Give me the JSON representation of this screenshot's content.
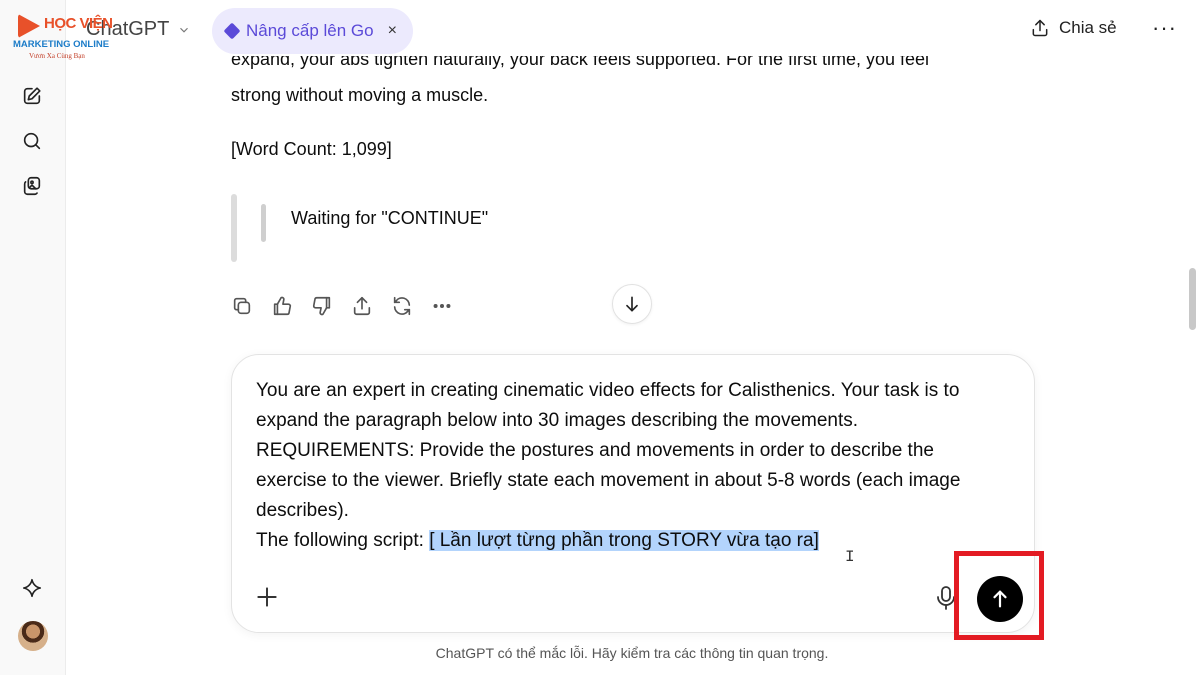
{
  "watermark": {
    "line1": "HỌC VIỆN",
    "line2": "MARKETING ONLINE",
    "line3": "Vươn Xa Cùng Bạn"
  },
  "header": {
    "model_name": "ChatGPT",
    "upgrade_label": "Nâng cấp lên Go",
    "upgrade_close": "×",
    "share_label": "Chia sẻ",
    "more_label": "···"
  },
  "conversation": {
    "cut_line": "expand, your abs tighten naturally, your back feels supported. For the first time, you feel",
    "line_strong": "strong without moving a muscle.",
    "word_count": "[Word Count: 1,099]",
    "waiting": "Waiting for \"CONTINUE\""
  },
  "composer": {
    "line1": "You are an expert in creating cinematic video effects for Calisthenics. Your task is to",
    "line2": "expand the paragraph below into 30 images describing the movements.",
    "line3": "REQUIREMENTS: Provide the postures and movements in order to describe the",
    "line4": "exercise to the viewer. Briefly state each movement in about 5-8 words (each image",
    "line5": "describes).",
    "line6_prefix": "The following script: ",
    "line6_highlight": "[ Lần lượt từng phần trong STORY vừa tạo ra]",
    "cursor": "I"
  },
  "footer": {
    "disclaimer": "ChatGPT có thể mắc lỗi. Hãy kiểm tra các thông tin quan trọng."
  },
  "colors": {
    "accent": "#5b4ad8",
    "highlight": "#b3d4fc",
    "annotation": "#e31b23",
    "watermark_orange": "#e8512a",
    "watermark_blue": "#1c7cc8"
  },
  "icons": {
    "sidebar": [
      "new-chat-icon",
      "search-icon",
      "library-icon",
      "sparkle-icon"
    ],
    "actions": [
      "copy-icon",
      "thumbs-up-icon",
      "thumbs-down-icon",
      "share-icon",
      "regenerate-icon",
      "more-icon"
    ],
    "composer": [
      "plus-icon",
      "mic-icon",
      "arrow-up-icon"
    ]
  }
}
